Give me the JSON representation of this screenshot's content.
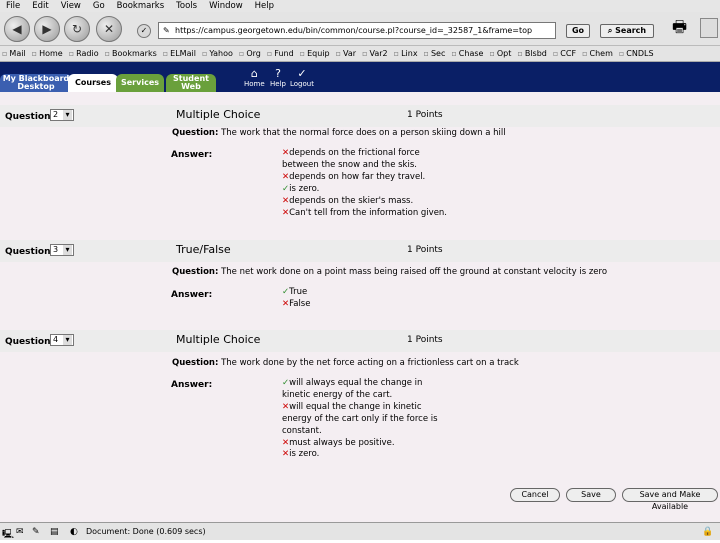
{
  "menu": [
    "File",
    "Edit",
    "View",
    "Go",
    "Bookmarks",
    "Tools",
    "Window",
    "Help"
  ],
  "nav": {
    "back": "◀",
    "forward": "▶",
    "reload": "↻",
    "stop": "✕",
    "url": "https://campus.georgetown.edu/bin/common/course.pl?course_id=_32587_1&frame=top",
    "go_label": "Go",
    "search_label": "Search"
  },
  "bookmarks": [
    "Mail",
    "Home",
    "Radio",
    "Bookmarks",
    "ELMail",
    "Yahoo",
    "Org",
    "Fund",
    "Equip",
    "Var",
    "Var2",
    "Linx",
    "Sec",
    "Chase",
    "Opt",
    "Blsbd",
    "CCF",
    "Chem",
    "CNDLS"
  ],
  "tabs": {
    "desktop": "My Blackboard Desktop",
    "courses": "Courses",
    "services": "Services",
    "student": "Student Web",
    "home": "Home",
    "help": "Help",
    "logout": "Logout"
  },
  "questions": [
    {
      "label": "Question",
      "number": "2",
      "type": "Multiple Choice",
      "points": "1 Points",
      "question_label": "Question:",
      "text": "The work that the normal force does on a person skiing down a hill",
      "answer_label": "Answer:",
      "answers": [
        {
          "mark": "✕",
          "correct": false,
          "text": "depends on the frictional force between the snow and the skis."
        },
        {
          "mark": "✕",
          "correct": false,
          "text": "depends on how far they travel."
        },
        {
          "mark": "✓",
          "correct": true,
          "text": "is zero."
        },
        {
          "mark": "✕",
          "correct": false,
          "text": "depends on the skier's mass."
        },
        {
          "mark": "✕",
          "correct": false,
          "text": "Can't tell from the information given."
        }
      ]
    },
    {
      "label": "Question",
      "number": "3",
      "type": "True/False",
      "points": "1 Points",
      "question_label": "Question:",
      "text": "The net work done on a point mass being raised off the ground at constant velocity is zero",
      "answer_label": "Answer:",
      "answers": [
        {
          "mark": "✓",
          "correct": true,
          "text": "True"
        },
        {
          "mark": "✕",
          "correct": false,
          "text": "False"
        }
      ]
    },
    {
      "label": "Question",
      "number": "4",
      "type": "Multiple Choice",
      "points": "1 Points",
      "question_label": "Question:",
      "text": "The work done by the net force acting on a frictionless cart on a track",
      "answer_label": "Answer:",
      "answers": [
        {
          "mark": "✓",
          "correct": true,
          "text": "will always equal the change in kinetic energy of the cart."
        },
        {
          "mark": "✕",
          "correct": false,
          "text": "will equal the change in kinetic energy of the cart only if the force is constant."
        },
        {
          "mark": "✕",
          "correct": false,
          "text": "must always be positive."
        },
        {
          "mark": "✕",
          "correct": false,
          "text": "is zero."
        }
      ]
    }
  ],
  "actions": {
    "cancel": "Cancel",
    "save": "Save",
    "save_available": "Save and Make Available"
  },
  "status": {
    "text": "Document: Done (0.609 secs)"
  },
  "colors": {
    "correct": "#2a8a2a",
    "incorrect": "#cc0000",
    "tabbar": "#0a1f66"
  }
}
